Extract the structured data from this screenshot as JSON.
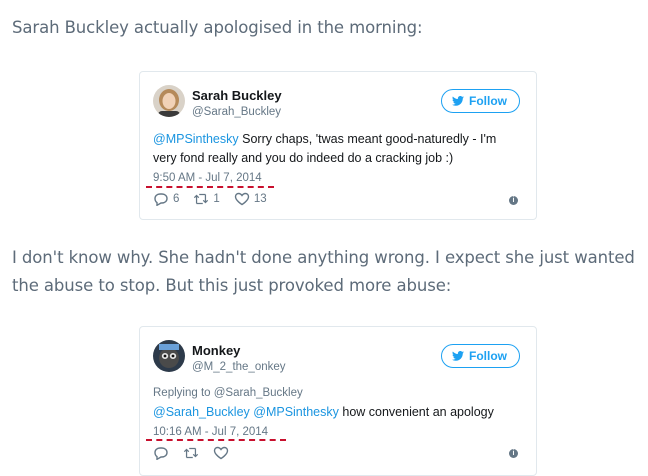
{
  "article": {
    "para1": "Sarah Buckley actually apologised in the morning:",
    "para2": "I don't know why. She hadn't done anything wrong. I expect she just wanted the abuse to stop. But this just provoked more abuse:"
  },
  "tweet1": {
    "name": "Sarah Buckley",
    "handle": "@Sarah_Buckley",
    "follow_label": "Follow",
    "mention": "@MPSinthesky",
    "text": " Sorry chaps, 'twas meant good-naturedly - I'm very fond really and you do indeed do a cracking job :)",
    "timestamp": "9:50 AM - Jul 7, 2014",
    "replies": "6",
    "retweets": "1",
    "likes": "13"
  },
  "tweet2": {
    "name": "Monkey",
    "handle": "@M_2_the_onkey",
    "follow_label": "Follow",
    "replying_prefix": "Replying to ",
    "replying_to": "@Sarah_Buckley",
    "mention1": "@Sarah_Buckley",
    "mention2": "@MPSinthesky",
    "text": " how convenient an apology",
    "timestamp": "10:16 AM - Jul 7, 2014"
  },
  "colors": {
    "twitter_blue": "#1da1f2",
    "mention_blue": "#1b95e0",
    "highlight_red": "#c8102e"
  },
  "icons": [
    "twitter-bird-icon",
    "reply-icon",
    "retweet-icon",
    "heart-icon",
    "info-icon"
  ]
}
